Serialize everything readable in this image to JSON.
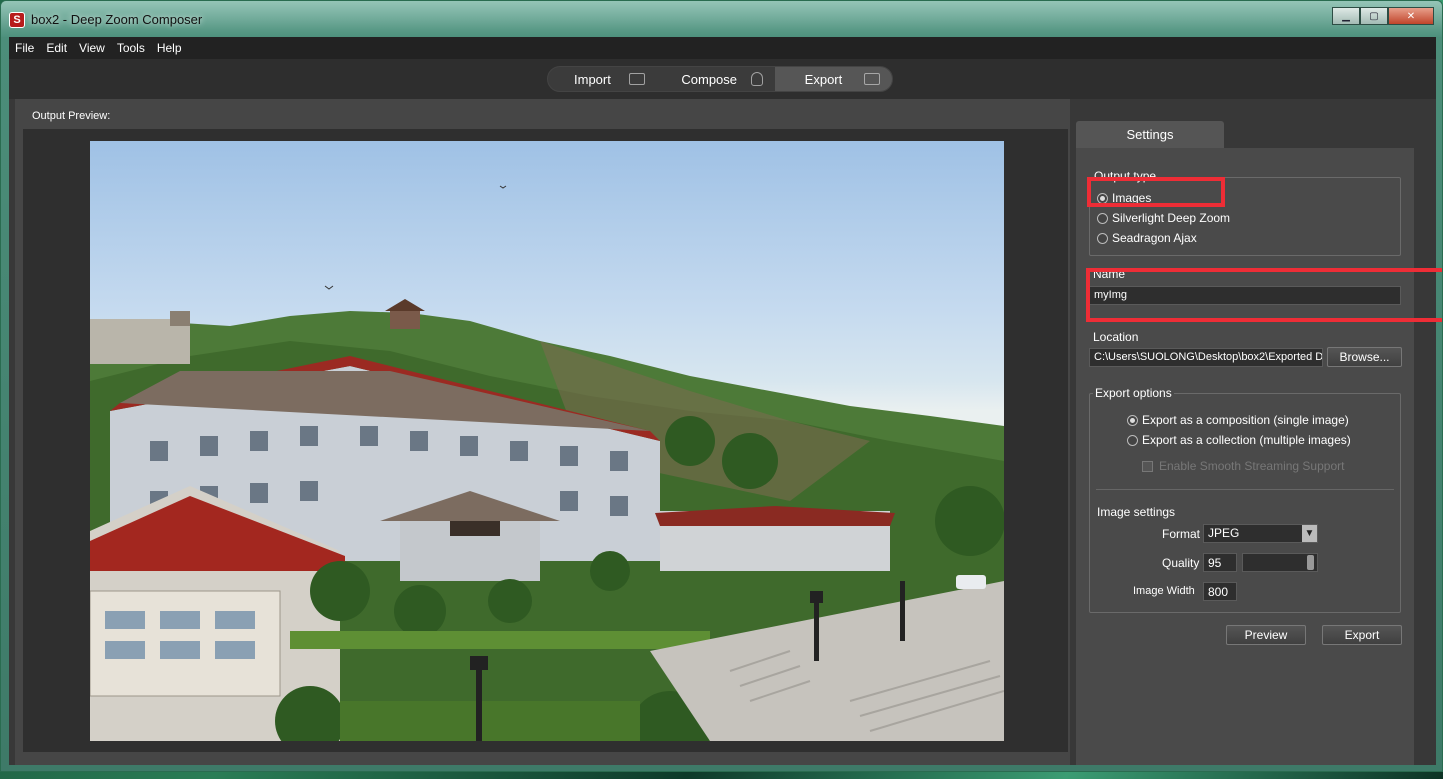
{
  "window": {
    "title": "box2 - Deep Zoom Composer"
  },
  "menu": [
    "File",
    "Edit",
    "View",
    "Tools",
    "Help"
  ],
  "modes": {
    "import": "Import",
    "compose": "Compose",
    "export": "Export"
  },
  "preview": {
    "label": "Output Preview:"
  },
  "settings": {
    "tab": "Settings",
    "output_type": {
      "label": "Output type",
      "options": [
        "Images",
        "Silverlight Deep Zoom",
        "Seadragon Ajax"
      ],
      "selected": "Images"
    },
    "name": {
      "label": "Name",
      "value": "myImg"
    },
    "location": {
      "label": "Location",
      "value": "C:\\Users\\SUOLONG\\Desktop\\box2\\Exported D",
      "browse": "Browse..."
    },
    "export_options": {
      "label": "Export options",
      "composition": "Export as a composition (single image)",
      "collection": "Export as a collection (multiple images)",
      "smooth_streaming": "Enable Smooth Streaming Support"
    },
    "image_settings": {
      "label": "Image settings",
      "format_label": "Format",
      "format_value": "JPEG",
      "quality_label": "Quality",
      "quality_value": "95",
      "width_label": "Image Width",
      "width_value": "800"
    },
    "preview_button": "Preview",
    "export_button": "Export"
  },
  "colors": {
    "highlight": "#ee2d36",
    "panel": "#4a4a4a",
    "background": "#383838"
  }
}
